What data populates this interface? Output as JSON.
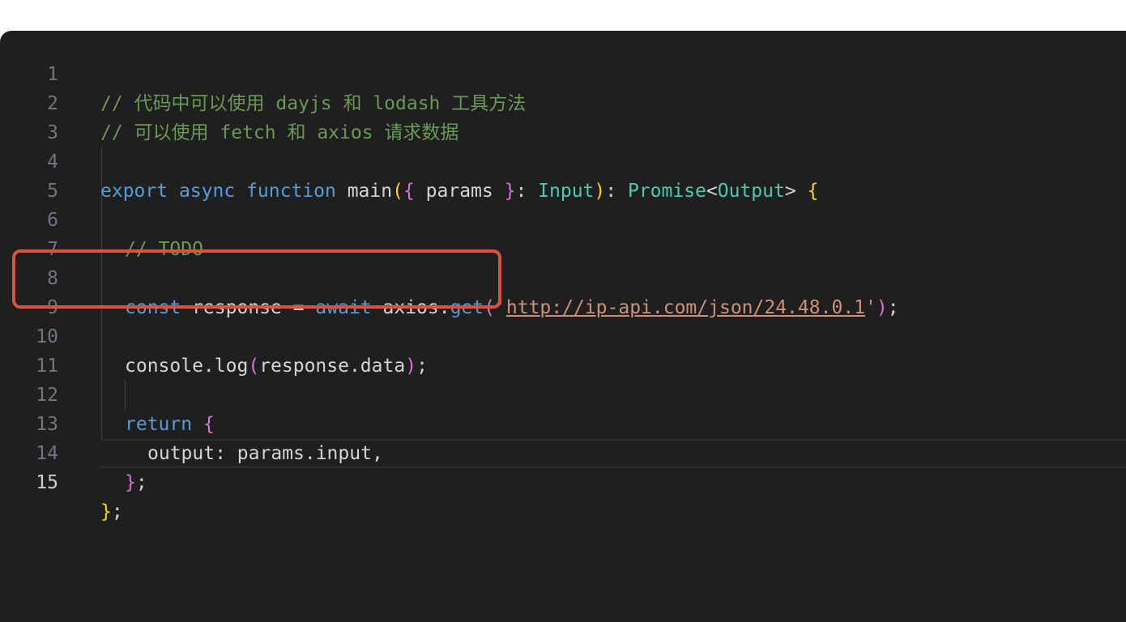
{
  "editor": {
    "line_numbers": [
      "1",
      "2",
      "3",
      "4",
      "5",
      "6",
      "7",
      "8",
      "9",
      "10",
      "11",
      "12",
      "13",
      "14",
      "15"
    ],
    "active_line": "15",
    "lines": {
      "l1": {
        "comment": "// 代码中可以使用 dayjs 和 lodash 工具方法"
      },
      "l2": {
        "comment": "// 可以使用 fetch 和 axios 请求数据"
      },
      "l4": {
        "export": "export",
        "async": "async",
        "function": "function",
        "name": "main",
        "open_paren": "(",
        "open_brace": "{",
        "param": " params ",
        "close_brace": "}",
        "colon1": ": ",
        "input_type": "Input",
        "close_paren": ")",
        "colon2": ": ",
        "promise": "Promise",
        "lt": "<",
        "output_type": "Output",
        "gt": "> ",
        "body_brace": "{"
      },
      "l6": {
        "comment": "// TODO"
      },
      "l8": {
        "const": "const",
        "var": " response = ",
        "await": "await",
        "obj": " axios.",
        "method": "get",
        "open_paren": "(",
        "quote_open": "'",
        "url": "http://ip-api.com/json/24.48.0.1",
        "quote_close": "'",
        "close_paren": ")",
        "semi": ";"
      },
      "l10": {
        "text_before": "console.log",
        "open_paren": "(",
        "arg": "response.data",
        "close_paren": ")",
        "semi": ";"
      },
      "l12": {
        "return": "return",
        "space": " ",
        "brace": "{"
      },
      "l13": {
        "text": "output: params.input,"
      },
      "l14": {
        "brace": "}",
        "semi": ";"
      },
      "l15": {
        "brace": "}",
        "semi": ";"
      }
    }
  }
}
